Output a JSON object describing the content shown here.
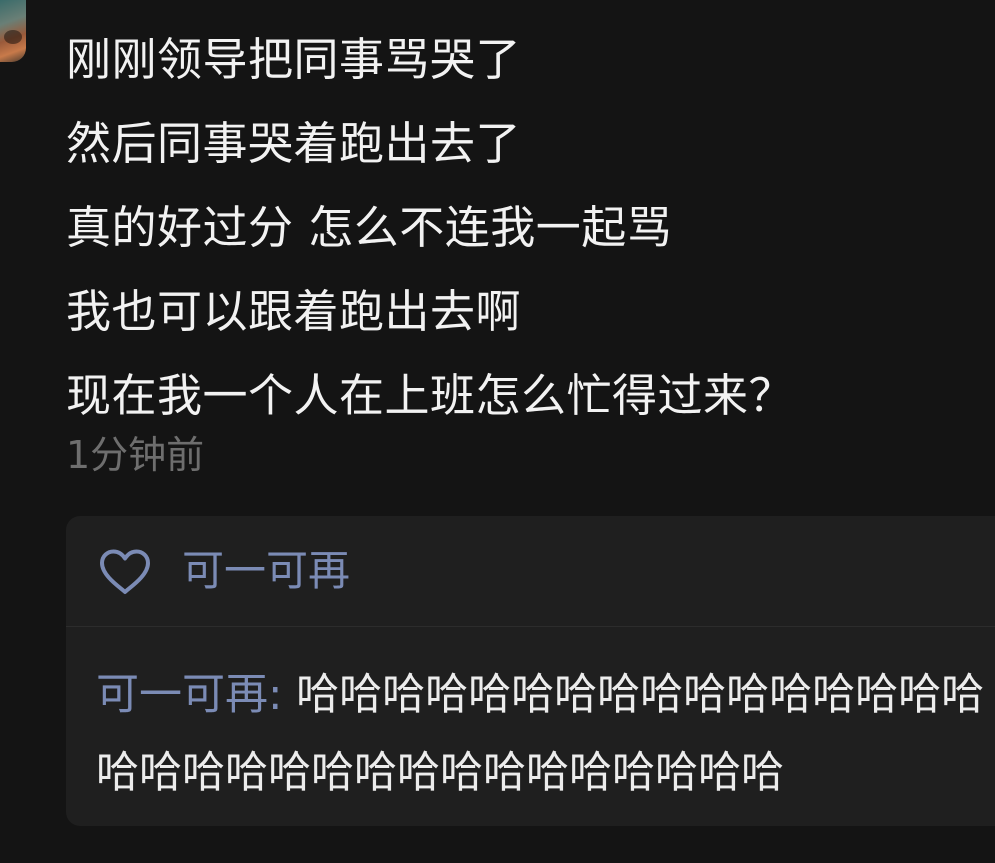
{
  "post": {
    "lines": [
      "刚刚领导把同事骂哭了",
      "然后同事哭着跑出去了",
      "真的好过分 怎么不连我一起骂",
      "我也可以跟着跑出去啊",
      "现在我一个人在上班怎么忙得过来？"
    ],
    "timestamp": "1分钟前"
  },
  "interactions": {
    "like_icon": "heart-outline-icon",
    "liker": "可一可再",
    "comment": {
      "author": "可一可再",
      "separator": ": ",
      "text": "哈哈哈哈哈哈哈哈哈哈哈哈哈哈哈哈哈哈哈哈哈哈哈哈哈哈哈哈哈哈哈哈"
    }
  },
  "colors": {
    "background": "#141414",
    "panel": "#1f1f1f",
    "text": "#f2f2f2",
    "muted": "#6e6e6e",
    "link": "#7b8bb5"
  }
}
